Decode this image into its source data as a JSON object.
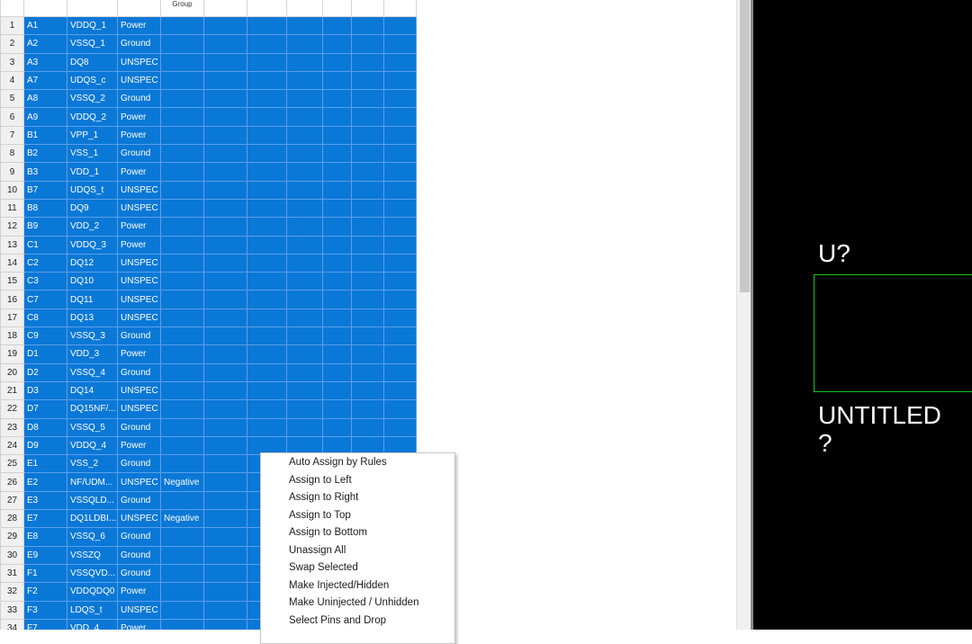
{
  "table": {
    "header": [
      "",
      "",
      "",
      "",
      "Group",
      "",
      "",
      "",
      "",
      "",
      ""
    ],
    "rows": [
      {
        "num": "1",
        "pin": "A1",
        "name": "VDDQ_1",
        "type": "Power",
        "extra": ""
      },
      {
        "num": "2",
        "pin": "A2",
        "name": "VSSQ_1",
        "type": "Ground",
        "extra": ""
      },
      {
        "num": "3",
        "pin": "A3",
        "name": "DQ8",
        "type": "UNSPEC",
        "extra": ""
      },
      {
        "num": "4",
        "pin": "A7",
        "name": "UDQS_c",
        "type": "UNSPEC",
        "extra": ""
      },
      {
        "num": "5",
        "pin": "A8",
        "name": "VSSQ_2",
        "type": "Ground",
        "extra": ""
      },
      {
        "num": "6",
        "pin": "A9",
        "name": "VDDQ_2",
        "type": "Power",
        "extra": ""
      },
      {
        "num": "7",
        "pin": "B1",
        "name": "VPP_1",
        "type": "Power",
        "extra": ""
      },
      {
        "num": "8",
        "pin": "B2",
        "name": "VSS_1",
        "type": "Ground",
        "extra": ""
      },
      {
        "num": "9",
        "pin": "B3",
        "name": "VDD_1",
        "type": "Power",
        "extra": ""
      },
      {
        "num": "10",
        "pin": "B7",
        "name": "UDQS_t",
        "type": "UNSPEC",
        "extra": ""
      },
      {
        "num": "11",
        "pin": "B8",
        "name": "DQ9",
        "type": "UNSPEC",
        "extra": ""
      },
      {
        "num": "12",
        "pin": "B9",
        "name": "VDD_2",
        "type": "Power",
        "extra": ""
      },
      {
        "num": "13",
        "pin": "C1",
        "name": "VDDQ_3",
        "type": "Power",
        "extra": ""
      },
      {
        "num": "14",
        "pin": "C2",
        "name": "DQ12",
        "type": "UNSPEC",
        "extra": ""
      },
      {
        "num": "15",
        "pin": "C3",
        "name": "DQ10",
        "type": "UNSPEC",
        "extra": ""
      },
      {
        "num": "16",
        "pin": "C7",
        "name": "DQ11",
        "type": "UNSPEC",
        "extra": ""
      },
      {
        "num": "17",
        "pin": "C8",
        "name": "DQ13",
        "type": "UNSPEC",
        "extra": ""
      },
      {
        "num": "18",
        "pin": "C9",
        "name": "VSSQ_3",
        "type": "Ground",
        "extra": ""
      },
      {
        "num": "19",
        "pin": "D1",
        "name": "VDD_3",
        "type": "Power",
        "extra": ""
      },
      {
        "num": "20",
        "pin": "D2",
        "name": "VSSQ_4",
        "type": "Ground",
        "extra": ""
      },
      {
        "num": "21",
        "pin": "D3",
        "name": "DQ14",
        "type": "UNSPEC",
        "extra": ""
      },
      {
        "num": "22",
        "pin": "D7",
        "name": "DQ15NF/...",
        "type": "UNSPEC",
        "extra": ""
      },
      {
        "num": "23",
        "pin": "D8",
        "name": "VSSQ_5",
        "type": "Ground",
        "extra": ""
      },
      {
        "num": "24",
        "pin": "D9",
        "name": "VDDQ_4",
        "type": "Power",
        "extra": ""
      },
      {
        "num": "25",
        "pin": "E1",
        "name": "VSS_2",
        "type": "Ground",
        "extra": ""
      },
      {
        "num": "26",
        "pin": "E2",
        "name": "NF/UDM...",
        "type": "UNSPEC",
        "extra": "Negative"
      },
      {
        "num": "27",
        "pin": "E3",
        "name": "VSSQLD...",
        "type": "Ground",
        "extra": ""
      },
      {
        "num": "28",
        "pin": "E7",
        "name": "DQ1LDBI...",
        "type": "UNSPEC",
        "extra": "Negative"
      },
      {
        "num": "29",
        "pin": "E8",
        "name": "VSSQ_6",
        "type": "Ground",
        "extra": ""
      },
      {
        "num": "30",
        "pin": "E9",
        "name": "VSSZQ",
        "type": "Ground",
        "extra": ""
      },
      {
        "num": "31",
        "pin": "F1",
        "name": "VSSQVD...",
        "type": "Ground",
        "extra": ""
      },
      {
        "num": "32",
        "pin": "F2",
        "name": "VDDQDQ0",
        "type": "Power",
        "extra": ""
      },
      {
        "num": "33",
        "pin": "F3",
        "name": "LDQS_t",
        "type": "UNSPEC",
        "extra": ""
      },
      {
        "num": "34",
        "pin": "F7",
        "name": "VDD_4",
        "type": "Power",
        "extra": ""
      }
    ]
  },
  "preview": {
    "ref_designator": "U?",
    "part_name": "UNTITLED",
    "part_name_line2": "?"
  },
  "context_menu": {
    "items": [
      "Auto Assign by Rules",
      "Assign to Left",
      "Assign to Right",
      "Assign to Top",
      "Assign to Bottom",
      "Unassign All",
      "Swap Selected",
      "Make Injected/Hidden",
      "Make Uninjected / Unhidden",
      "Select Pins and Drop"
    ]
  },
  "colors": {
    "selection": "#0a78d7",
    "preview_bg": "#000000",
    "part_outline": "#19c819"
  }
}
